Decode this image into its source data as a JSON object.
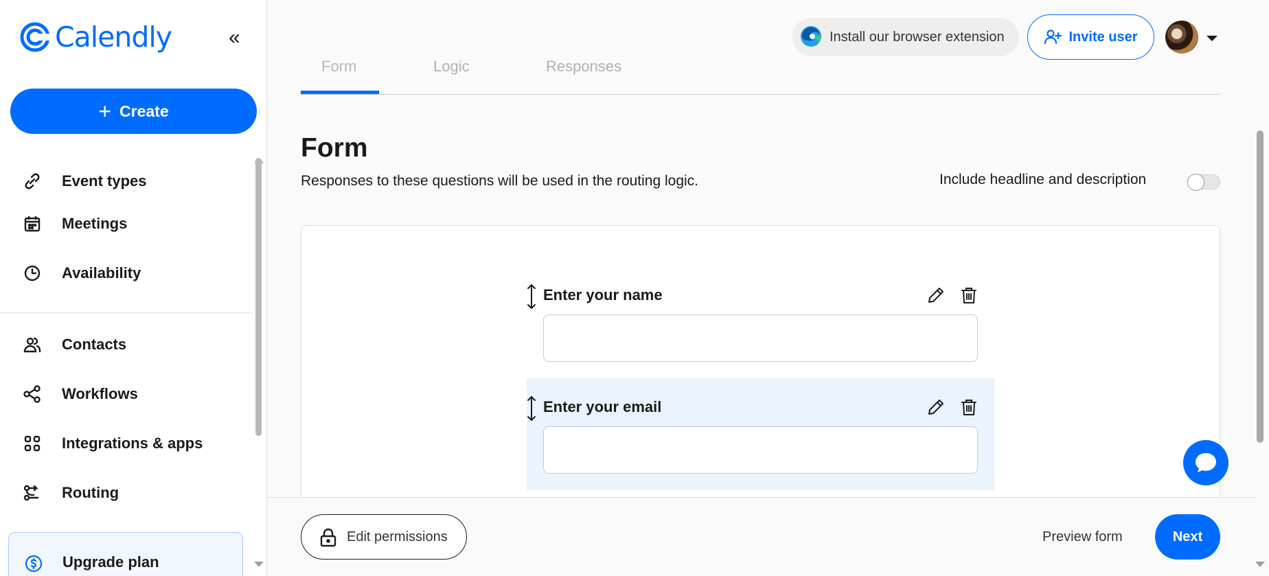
{
  "brand": {
    "name": "Calendly",
    "accent": "#006bff"
  },
  "sidebar": {
    "create_label": "Create",
    "items": [
      {
        "label": "Event types",
        "icon": "link-icon"
      },
      {
        "label": "Meetings",
        "icon": "calendar-icon"
      },
      {
        "label": "Availability",
        "icon": "clock-icon"
      },
      {
        "label": "Contacts",
        "icon": "contacts-icon"
      },
      {
        "label": "Workflows",
        "icon": "workflow-icon"
      },
      {
        "label": "Integrations & apps",
        "icon": "grid-icon"
      },
      {
        "label": "Routing",
        "icon": "routing-icon"
      }
    ],
    "upgrade_label": "Upgrade plan"
  },
  "topbar": {
    "extension_label": "Install our browser extension",
    "invite_label": "Invite user"
  },
  "tabs": [
    {
      "label": "Form",
      "active": true
    },
    {
      "label": "Logic",
      "active": false
    },
    {
      "label": "Responses",
      "active": false
    }
  ],
  "form": {
    "title": "Form",
    "description": "Responses to these questions will be used in the routing logic.",
    "toggle_label": "Include headline and description",
    "toggle_on": false,
    "fields": [
      {
        "label": "Enter your name",
        "value": ""
      },
      {
        "label": "Enter your email",
        "value": ""
      }
    ]
  },
  "footer": {
    "permissions_label": "Edit permissions",
    "preview_label": "Preview form",
    "next_label": "Next"
  }
}
